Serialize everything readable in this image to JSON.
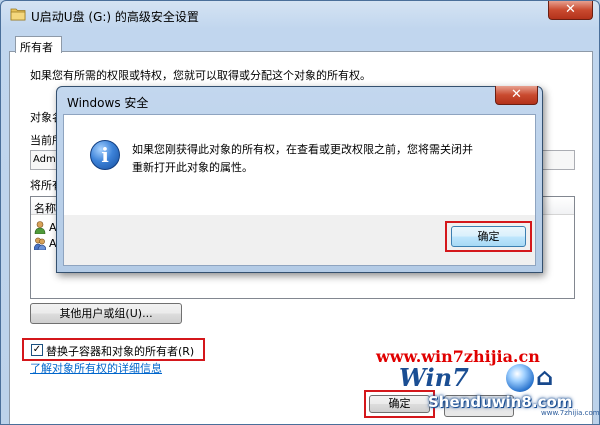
{
  "window": {
    "title": "U启动U盘 (G:) 的高级安全设置",
    "close_glyph": "✕"
  },
  "tab": {
    "label": "所有者"
  },
  "main": {
    "intro": "如果您有所需的权限或特权，您就可以取得或分配这个对象的所有权。",
    "object_label": "对象名",
    "current_owner_label": "当前所",
    "owner_value": "Admi",
    "change_owner_label": "将所有",
    "list_header": "名称",
    "list_items": [
      "A",
      "A"
    ],
    "other_users_button": "其他用户或组(U)...",
    "replace_owner_checkbox": "替换子容器和对象的所有者(R)",
    "replace_checked": true,
    "learn_more_link": "了解对象所有权的详细信息",
    "ok_button": "确定"
  },
  "dialog": {
    "title": "Windows 安全",
    "message_line1": "如果您刚获得此对象的所有权，在查看或更改权限之前，您将需关闭并",
    "message_line2": "重新打开此对象的属性。",
    "ok_button": "确定",
    "icon": "info-icon",
    "close_glyph": "✕"
  },
  "watermark": {
    "url": "www.win7zhijia.cn",
    "logo": "Win7",
    "site": "Shenduwin8.com",
    "small": "www.7zhijia.com"
  },
  "colors": {
    "highlight_red": "#d4171b",
    "link_blue": "#0066cc",
    "watermark_red": "#e00000"
  }
}
